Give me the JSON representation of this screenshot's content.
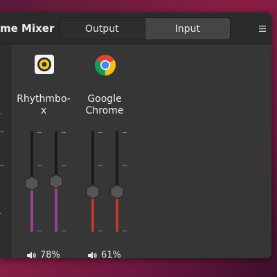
{
  "header": {
    "title": "me Mixer",
    "tabs": [
      {
        "label": "Output",
        "active": false
      },
      {
        "label": "Input",
        "active": true
      }
    ],
    "menu_icon": "hamburger-menu-icon"
  },
  "apps": [
    {
      "name": "Rhythmbo-\nx",
      "icon": "rhythmbox-icon",
      "volume_label": "78%",
      "volume": 0.78,
      "channels": [
        0.48,
        0.5
      ],
      "fill_color": "#9b3f96"
    },
    {
      "name": "Google\nChrome",
      "icon": "google-chrome-icon",
      "volume_label": "61%",
      "volume": 0.61,
      "channels": [
        0.4,
        0.4
      ],
      "fill_color": "#c0392b"
    }
  ],
  "colors": {
    "window_bg": "#303030",
    "headerbar_bg": "#2b2b2b",
    "active_tab_bg": "#454545",
    "desktop_accent": "#8a1e45"
  }
}
